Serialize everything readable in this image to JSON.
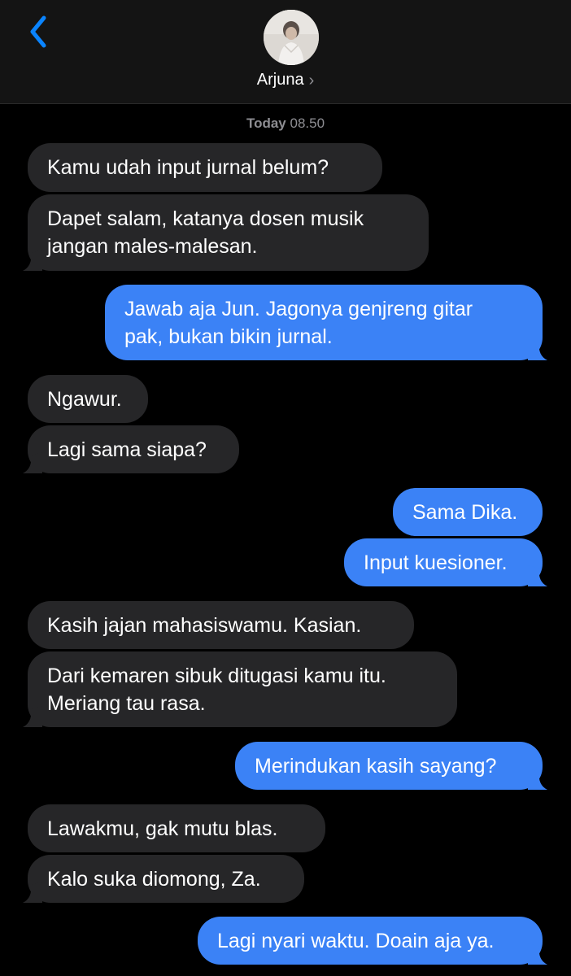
{
  "header": {
    "contact_name": "Arjuna",
    "chevron": "›",
    "back_icon": "chevron-left-icon"
  },
  "timestamp": {
    "day": "Today",
    "time": "08.50"
  },
  "colors": {
    "incoming_bubble": "#262628",
    "outgoing_bubble": "#3b82f6",
    "accent": "#0a84ff",
    "background": "#000000"
  },
  "messages": [
    {
      "dir": "in",
      "text": "Kamu udah input jurnal belum?"
    },
    {
      "dir": "in",
      "text": "Dapet salam, katanya dosen musik\njangan males-malesan."
    },
    {
      "dir": "out",
      "text": "Jawab aja Jun. Jagonya genjreng gitar\npak, bukan bikin jurnal."
    },
    {
      "dir": "in",
      "text": "Ngawur."
    },
    {
      "dir": "in",
      "text": "Lagi sama siapa?"
    },
    {
      "dir": "out",
      "text": "Sama Dika."
    },
    {
      "dir": "out",
      "text": "Input kuesioner."
    },
    {
      "dir": "in",
      "text": "Kasih jajan mahasiswamu. Kasian."
    },
    {
      "dir": "in",
      "text": "Dari kemaren sibuk ditugasi kamu itu.\nMeriang tau rasa."
    },
    {
      "dir": "out",
      "text": "Merindukan kasih sayang?"
    },
    {
      "dir": "in",
      "text": "Lawakmu, gak mutu blas."
    },
    {
      "dir": "in",
      "text": "Kalo suka diomong, Za."
    },
    {
      "dir": "out",
      "text": "Lagi nyari waktu. Doain aja ya."
    }
  ]
}
